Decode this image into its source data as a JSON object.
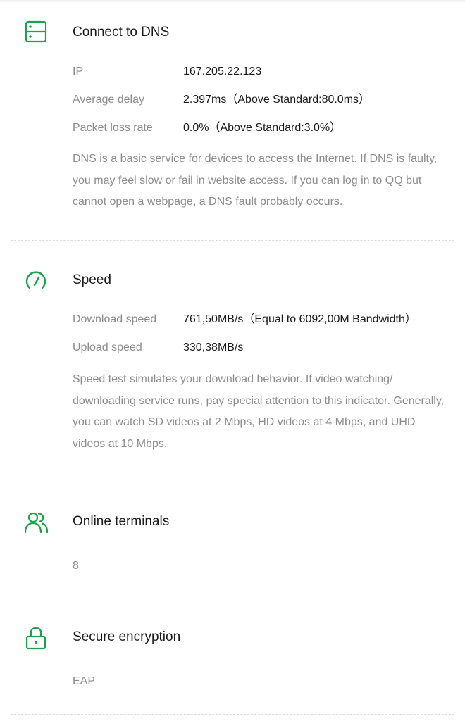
{
  "colors": {
    "accent": "#1aa34a",
    "text_primary": "#1a1a1a",
    "text_secondary": "#8c8c8c",
    "divider": "#dddddd"
  },
  "dns": {
    "icon": "server-icon",
    "title": "Connect to DNS",
    "rows": [
      {
        "label": "IP",
        "value": "167.205.22.123"
      },
      {
        "label": "Average delay",
        "value": "2.397ms（Above Standard:80.0ms）"
      },
      {
        "label": "Packet loss rate",
        "value": "0.0%（Above Standard:3.0%）"
      }
    ],
    "description": "DNS is a basic service for devices to access the Internet. If DNS is faulty, you may feel slow or fail in website access. If you can log in to QQ but cannot open a webpage, a DNS fault probably occurs."
  },
  "speed": {
    "icon": "speedometer-icon",
    "title": "Speed",
    "rows": [
      {
        "label": "Download speed",
        "value": "761,50MB/s（Equal to 6092,00M Bandwidth）"
      },
      {
        "label": "Upload speed",
        "value": "330,38MB/s"
      }
    ],
    "description": "Speed test simulates your download behavior. If video watching/ downloading service runs, pay special attention to this indicator. Generally, you can watch SD videos at 2 Mbps, HD videos at 4 Mbps, and UHD videos at 10 Mbps."
  },
  "terminals": {
    "icon": "users-icon",
    "title": "Online terminals",
    "value": "8"
  },
  "encryption": {
    "icon": "lock-icon",
    "title": "Secure encryption",
    "value": "EAP"
  }
}
